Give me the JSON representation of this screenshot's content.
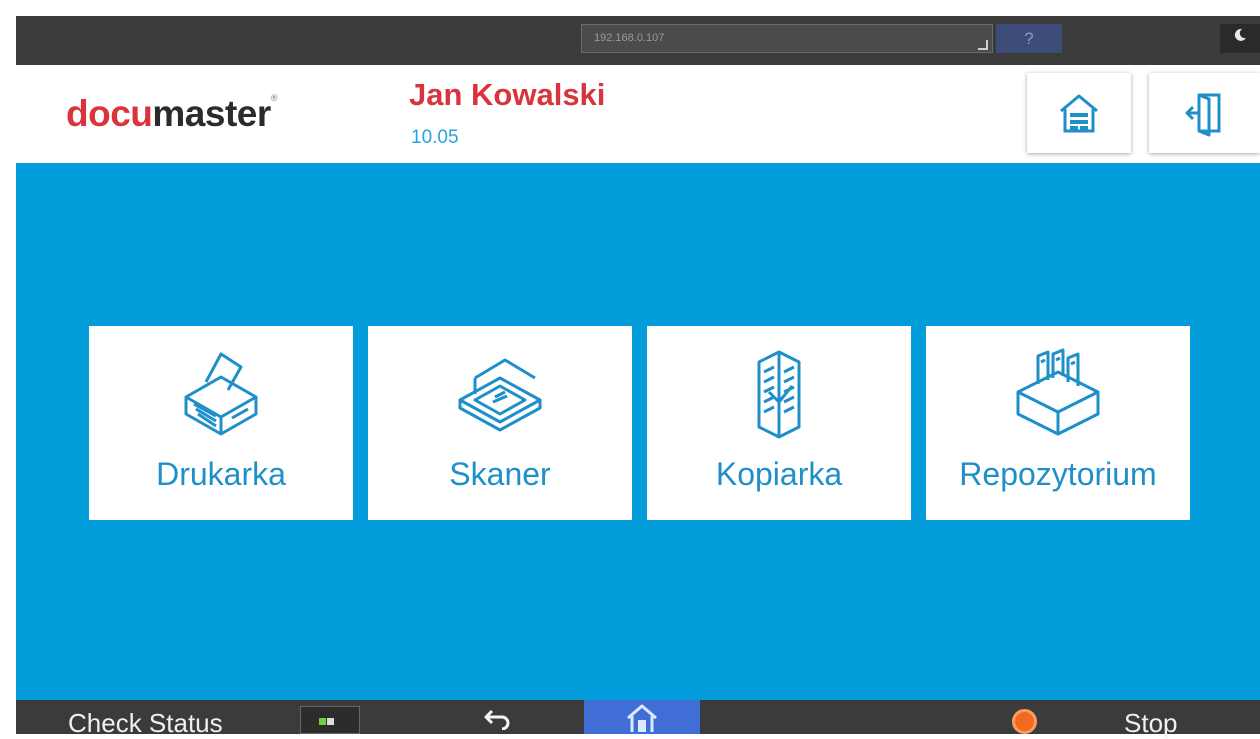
{
  "topbar": {
    "ip_address": "192.168.0.107",
    "help_label": "?"
  },
  "header": {
    "logo_part1": "docu",
    "logo_part2": "master",
    "logo_tm": "®",
    "user_name": "Jan Kowalski",
    "balance": "10.05",
    "home_icon": "home-icon",
    "logout_icon": "logout-icon"
  },
  "tiles": [
    {
      "label": "Drukarka",
      "icon": "printer-icon"
    },
    {
      "label": "Skaner",
      "icon": "scanner-icon"
    },
    {
      "label": "Kopiarka",
      "icon": "copier-icon"
    },
    {
      "label": "Repozytorium",
      "icon": "repository-icon"
    }
  ],
  "bottombar": {
    "check_status_label": "Check Status",
    "stop_label": "Stop"
  },
  "colors": {
    "brand_red": "#d9343c",
    "main_blue": "#039ddb",
    "tile_text": "#1f8fc9",
    "home_button_active": "#3f6fd6",
    "stop_orange": "#f26a21"
  }
}
